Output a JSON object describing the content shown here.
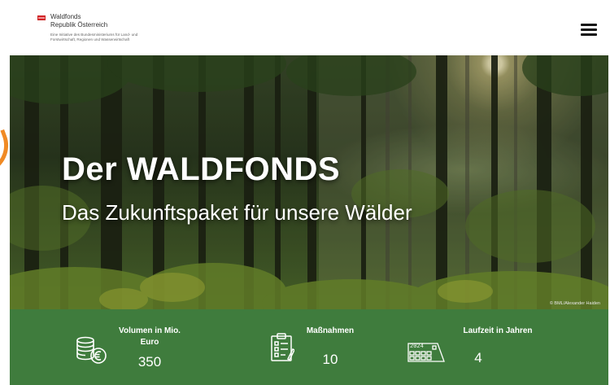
{
  "header": {
    "logo_line1": "Waldfonds",
    "logo_line2": "Republik Österreich",
    "logo_subtitle": "Eine Initiative des Bundesministeriums für Land- und Forstwirtschaft, Regionen und Wasserwirtschaft",
    "menu_icon": "hamburger-icon"
  },
  "hero": {
    "title": "Der WALDFONDS",
    "subtitle": "Das Zukunftspaket für unsere Wälder",
    "credit": "© BML/Alexander Haiden"
  },
  "stats": [
    {
      "icon": "coins-euro-icon",
      "label": "Volumen in Mio. Euro",
      "value": "350"
    },
    {
      "icon": "clipboard-checklist-icon",
      "label": "Maßnahmen",
      "value": "10"
    },
    {
      "icon": "calendar-icon",
      "icon_text": "2024",
      "label": "Laufzeit in Jahren",
      "value": "4"
    }
  ],
  "colors": {
    "stats_bar": "#3f7c3d",
    "accent": "#f08a24",
    "flag_red": "#d8232a"
  }
}
